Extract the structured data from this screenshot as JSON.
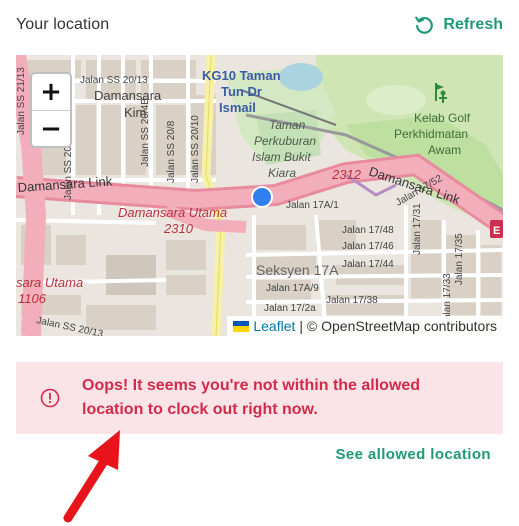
{
  "header": {
    "title": "Your location",
    "refresh_label": "Refresh",
    "accent_color": "#1f9a74"
  },
  "map": {
    "zoom_in_label": "+",
    "zoom_out_label": "−",
    "attribution_link": "Leaflet",
    "attribution_text": "| © OpenStreetMap contributors",
    "labels": {
      "jalan_ss2013": "Jalan SS 20/13",
      "jalan_ss2113": "Jalan SS 21/13",
      "damansara": "Damansara",
      "kim": "Kim",
      "jalan_ss2013b": "Jalan SS 20/13",
      "jalan_ss208": "Jalan SS 20/8",
      "jalan_ss2010": "Jalan SS 20/10",
      "jalan_ss2048": "Jalan SS 20/4B",
      "station_1": "KG10 Taman",
      "station_2": "Tun Dr",
      "station_3": "Ismail",
      "cemetery_1": "Taman",
      "cemetery_2": "Perkuburan",
      "cemetery_3": "Islam Bukit",
      "cemetery_4": "Kiara",
      "golf_1": "Kelab Golf",
      "golf_2": "Perkhidmatan",
      "golf_3": "Awam",
      "damansara_link_left": "Damansara Link",
      "damansara_link_right": "Damansara Link",
      "damansara_utama": "Damansara Utama",
      "route_2310": "2310",
      "route_2312": "2312",
      "jalan_17a1": "Jalan 17A/1",
      "jalan_1752": "Jalan 17/52",
      "jalan_1748": "Jalan 17/48",
      "jalan_1746": "Jalan 17/46",
      "jalan_1744": "Jalan 17/44",
      "jalan_1735": "Jalan 17/35",
      "jalan_1731": "Jalan 17/31",
      "seksyen": "Seksyen 17A",
      "jalan_17a9": "Jalan 17A/9",
      "jalan_1738": "Jalan 17/38",
      "jalan_17a": "Jalan 17/2a",
      "jalan_1733": "Jalan 17/33",
      "sara_utama": "sara Utama",
      "route_1106": "1106",
      "jalan_ss2013c": "Jalan SS 20/13",
      "e_marker": "E"
    }
  },
  "alert": {
    "message": "Oops! It seems you're not within the allowed location to clock out right now.",
    "color": "#d22a4a",
    "background": "#fbe4e8"
  },
  "link": {
    "see_allowed": "See allowed location"
  }
}
